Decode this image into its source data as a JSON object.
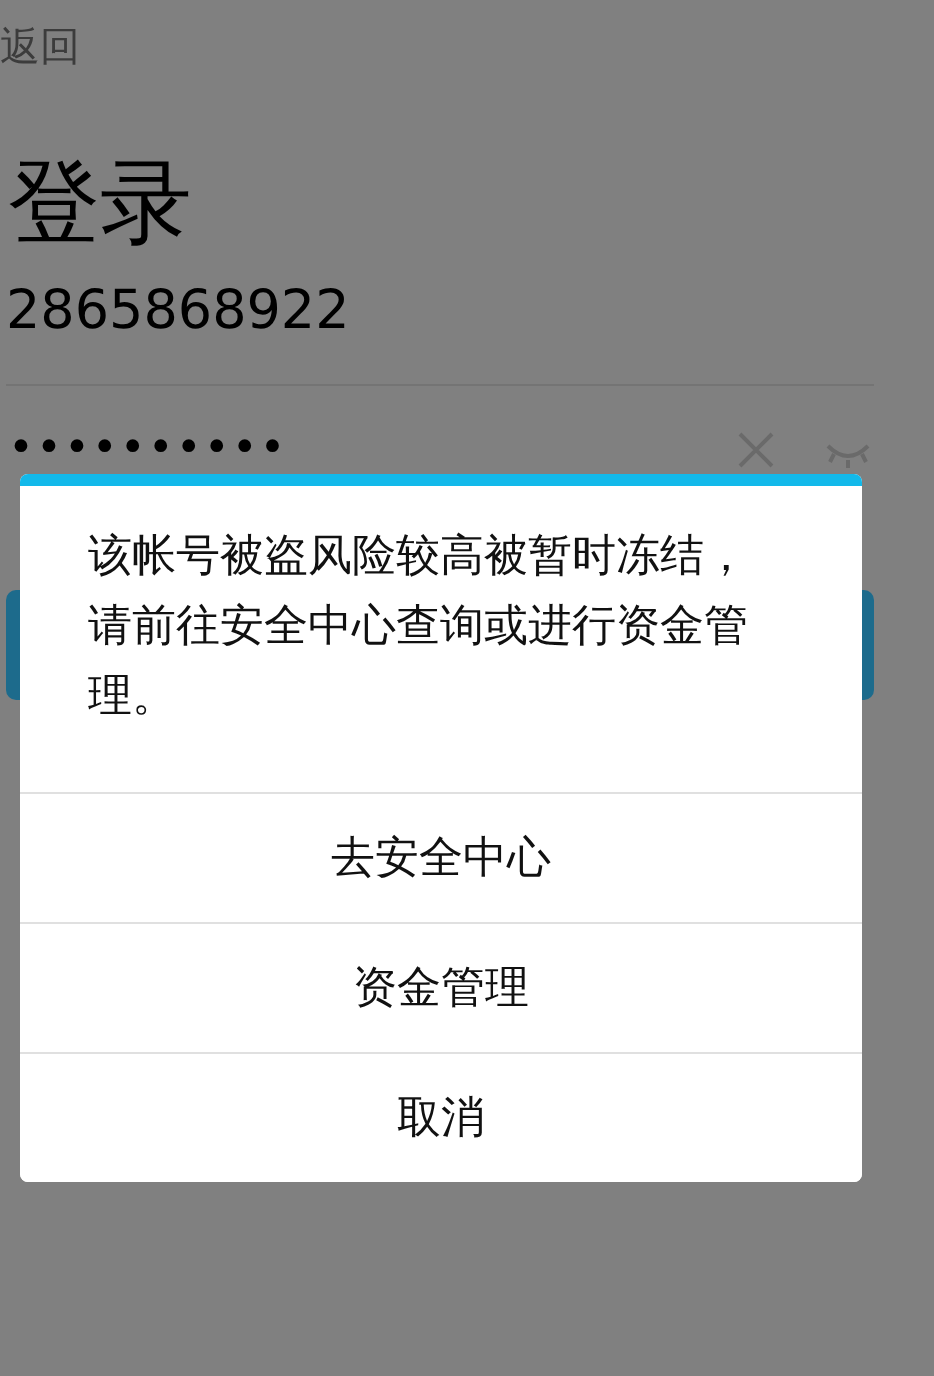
{
  "back": "返回",
  "title": "登录",
  "account": "2865868922",
  "password": {
    "value": "••••••••••"
  },
  "dialog": {
    "message": "该帐号被盗风险较高被暂时冻结，请前往安全中心查询或进行资金管理。",
    "actions": [
      "去安全中心",
      "资金管理",
      "取消"
    ]
  }
}
